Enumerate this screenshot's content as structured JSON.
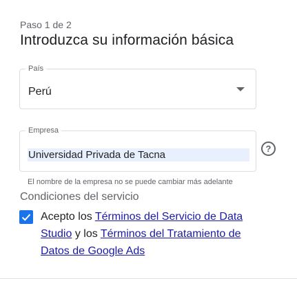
{
  "header": {
    "step": "Paso 1 de 2",
    "title": "Introduzca su información básica"
  },
  "country_field": {
    "label": "País",
    "value": "Perú"
  },
  "company_field": {
    "label": "Empresa",
    "value": "Universidad Privada de Tacna",
    "hint": "El nombre de la empresa no se puede cambiar más adelante"
  },
  "terms": {
    "section_title": "Condiciones del servicio",
    "checked": true,
    "prefix": "Acepto los ",
    "link1": "Términos del Servicio de Data Studio",
    "middle": " y los ",
    "link2": "Términos del Tratamiento de Datos de Google Ads"
  },
  "icons": {
    "help": "help-circle-icon",
    "dropdown": "arrow-drop-down-icon",
    "check": "check-icon"
  },
  "colors": {
    "accent": "#1a73e8",
    "autofill": "#e8f0fe",
    "link": "#1a1aa6"
  }
}
